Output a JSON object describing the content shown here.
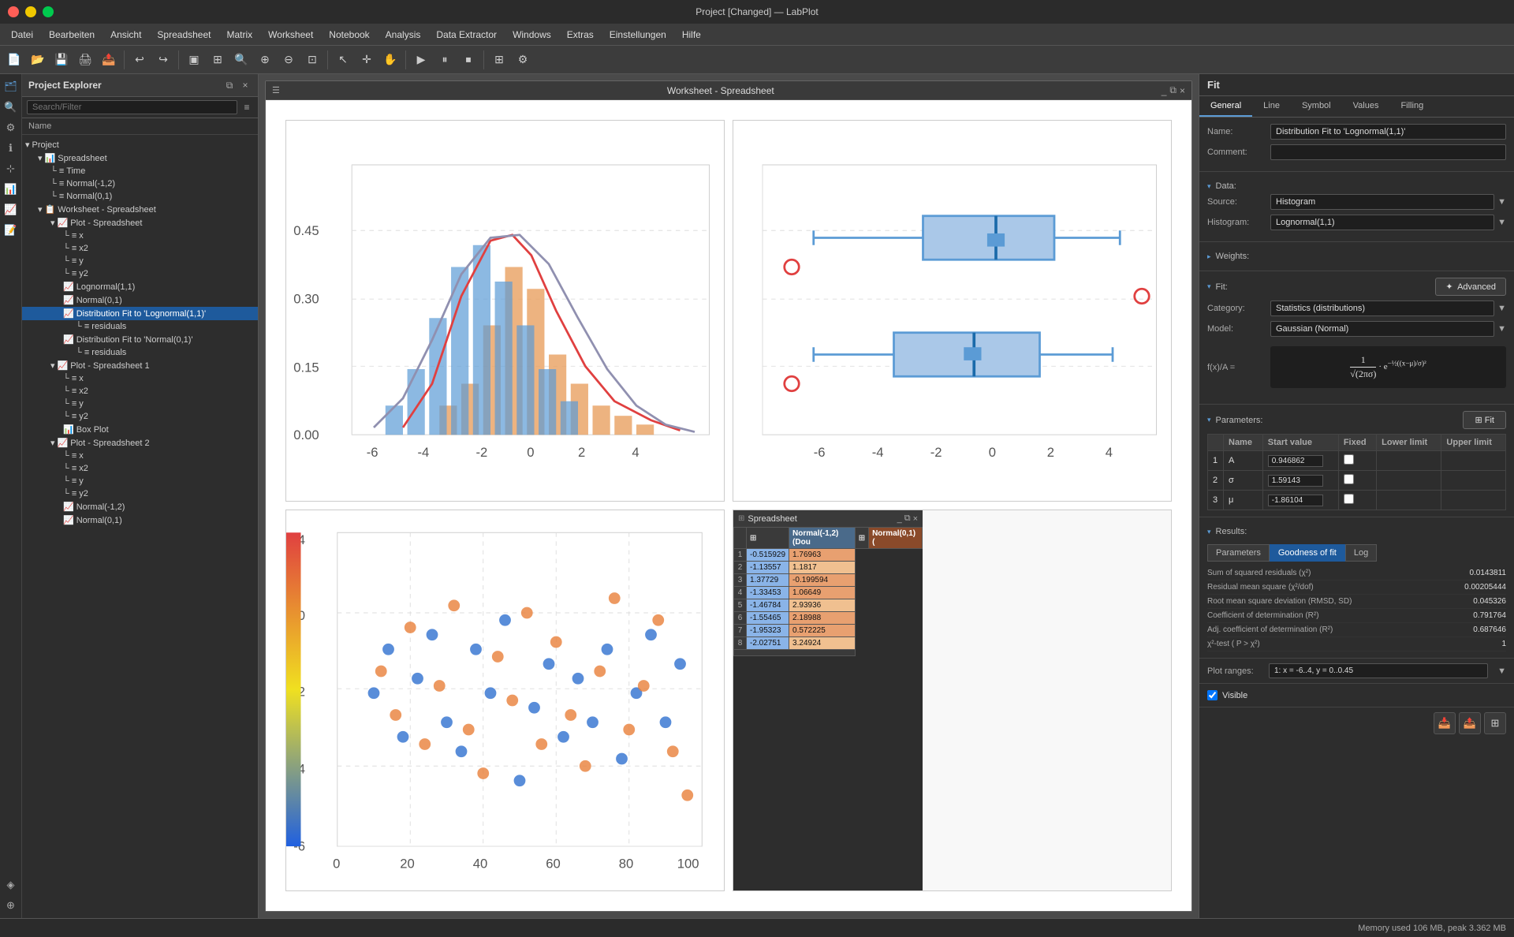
{
  "titlebar": {
    "title": "Project [Changed] — LabPlot",
    "minimize": "−",
    "maximize": "□",
    "close": "×"
  },
  "menubar": {
    "items": [
      "Datei",
      "Bearbeiten",
      "Ansicht",
      "Spreadsheet",
      "Matrix",
      "Worksheet",
      "Notebook",
      "Analysis",
      "Data Extractor",
      "Windows",
      "Extras",
      "Einstellungen",
      "Hilfe"
    ]
  },
  "left_panel": {
    "title": "Project Explorer",
    "search_placeholder": "Search/Filter",
    "name_label": "Name",
    "tree": [
      {
        "label": "Project",
        "type": "folder",
        "level": 0,
        "icon": "📁"
      },
      {
        "label": "Spreadsheet",
        "type": "spreadsheet",
        "level": 1,
        "icon": "📊"
      },
      {
        "label": "Time",
        "type": "column",
        "level": 2,
        "icon": "≡"
      },
      {
        "label": "Normal(-1,2)",
        "type": "column",
        "level": 2,
        "icon": "≡"
      },
      {
        "label": "Normal(0,1)",
        "type": "column",
        "level": 2,
        "icon": "≡"
      },
      {
        "label": "Worksheet - Spreadsheet",
        "type": "worksheet",
        "level": 1,
        "icon": "📋"
      },
      {
        "label": "Plot - Spreadsheet",
        "type": "plot",
        "level": 2,
        "icon": "📈"
      },
      {
        "label": "x",
        "type": "column",
        "level": 3,
        "icon": "└"
      },
      {
        "label": "x2",
        "type": "column",
        "level": 3,
        "icon": "└"
      },
      {
        "label": "y",
        "type": "column",
        "level": 3,
        "icon": "└"
      },
      {
        "label": "y2",
        "type": "column",
        "level": 3,
        "icon": "└"
      },
      {
        "label": "Lognormal(1,1)",
        "type": "dist",
        "level": 3,
        "icon": "📈"
      },
      {
        "label": "Normal(0,1)",
        "type": "dist",
        "level": 3,
        "icon": "📈"
      },
      {
        "label": "Distribution Fit to 'Lognormal(1,1)'",
        "type": "fit",
        "level": 3,
        "icon": "📈",
        "selected": true
      },
      {
        "label": "residuals",
        "type": "residuals",
        "level": 4,
        "icon": "└"
      },
      {
        "label": "Distribution Fit to 'Normal(0,1)'",
        "type": "fit",
        "level": 3,
        "icon": "📈"
      },
      {
        "label": "residuals",
        "type": "residuals",
        "level": 4,
        "icon": "└"
      },
      {
        "label": "Plot - Spreadsheet 1",
        "type": "plot",
        "level": 2,
        "icon": "📈"
      },
      {
        "label": "x",
        "type": "column",
        "level": 3,
        "icon": "└"
      },
      {
        "label": "x2",
        "type": "column",
        "level": 3,
        "icon": "└"
      },
      {
        "label": "y",
        "type": "column",
        "level": 3,
        "icon": "└"
      },
      {
        "label": "y2",
        "type": "column",
        "level": 3,
        "icon": "└"
      },
      {
        "label": "Box Plot",
        "type": "boxplot",
        "level": 3,
        "icon": "📊"
      },
      {
        "label": "Plot - Spreadsheet 2",
        "type": "plot",
        "level": 2,
        "icon": "📈"
      },
      {
        "label": "x",
        "type": "column",
        "level": 3,
        "icon": "└"
      },
      {
        "label": "x2",
        "type": "column",
        "level": 3,
        "icon": "└"
      },
      {
        "label": "y",
        "type": "column",
        "level": 3,
        "icon": "└"
      },
      {
        "label": "y2",
        "type": "column",
        "level": 3,
        "icon": "└"
      },
      {
        "label": "Normal(-1,2)",
        "type": "dist",
        "level": 3,
        "icon": "📈"
      },
      {
        "label": "Normal(0,1)",
        "type": "dist",
        "level": 3,
        "icon": "📈"
      }
    ]
  },
  "worksheet": {
    "title": "Worksheet - Spreadsheet"
  },
  "spreadsheet_popup": {
    "title": "Spreadsheet",
    "cols": [
      "Normal(-1,2) (Dou",
      "Normal(0,1) ("
    ],
    "rows": [
      {
        "num": 1,
        "col1": "-0.515929",
        "col2": "1.76963"
      },
      {
        "num": 2,
        "col1": "-1.13557",
        "col2": "1.1817"
      },
      {
        "num": 3,
        "col1": "1.37729",
        "col2": "-0.199594"
      },
      {
        "num": 4,
        "col1": "-1.33453",
        "col2": "1.06649"
      },
      {
        "num": 5,
        "col1": "-1.46784",
        "col2": "2.93936"
      },
      {
        "num": 6,
        "col1": "-1.55465",
        "col2": "2.18988"
      },
      {
        "num": 7,
        "col1": "-1.95323",
        "col2": "0.572225"
      },
      {
        "num": 8,
        "col1": "-2.02751",
        "col2": "3.24924"
      }
    ]
  },
  "fit_panel": {
    "header": "Fit",
    "tabs": [
      "General",
      "Line",
      "Symbol",
      "Values",
      "Filling"
    ],
    "active_tab": "General",
    "name_label": "Name:",
    "name_value": "Distribution Fit to 'Lognormal(1,1)'",
    "comment_label": "Comment:",
    "comment_value": "",
    "data_section": "Data:",
    "source_label": "Source:",
    "source_value": "Histogram",
    "histogram_label": "Histogram:",
    "histogram_value": "Lognormal(1,1)",
    "weights_section": "Weights:",
    "fit_section": "Fit:",
    "advanced_btn": "Advanced",
    "category_label": "Category:",
    "category_value": "Statistics (distributions)",
    "model_label": "Model:",
    "model_value": "Gaussian (Normal)",
    "formula_prefix": "f(x)/A =",
    "formula": "1/(√(2πσ)) · e^(−½((x−μ)/σ)²)",
    "params_section": "Parameters:",
    "params_headers": [
      "Name",
      "Start value",
      "Fixed",
      "Lower limit",
      "Upper limit"
    ],
    "params": [
      {
        "num": 1,
        "name": "A",
        "start": "0.946862",
        "fixed": false,
        "lower": "",
        "upper": ""
      },
      {
        "num": 2,
        "name": "σ",
        "start": "1.59143",
        "fixed": false,
        "lower": "",
        "upper": ""
      },
      {
        "num": 3,
        "name": "μ",
        "start": "-1.86104",
        "fixed": false,
        "lower": "",
        "upper": ""
      }
    ],
    "fit_button": "Fit",
    "results_section": "Results:",
    "results_tabs": [
      "Parameters",
      "Goodness of fit",
      "Log"
    ],
    "active_results_tab": "Goodness of fit",
    "goodness": [
      {
        "key": "Sum of squared residuals (χ²)",
        "val": "0.0143811"
      },
      {
        "key": "Residual mean square (χ²/dof)",
        "val": "0.00205444"
      },
      {
        "key": "Root mean square deviation (RMSD, SD)",
        "val": "0.045326"
      },
      {
        "key": "Coefficient of determination (R²)",
        "val": "0.791764"
      },
      {
        "key": "Adj. coefficient of determination (R²)",
        "val": "0.687646"
      },
      {
        "key": "χ²-test ( P > χ²)",
        "val": "1"
      }
    ],
    "plot_ranges_label": "Plot ranges:",
    "plot_ranges_value": "1: x = -6..4, y = 0..0.45",
    "visible_label": "Visible",
    "visible_checked": true
  }
}
